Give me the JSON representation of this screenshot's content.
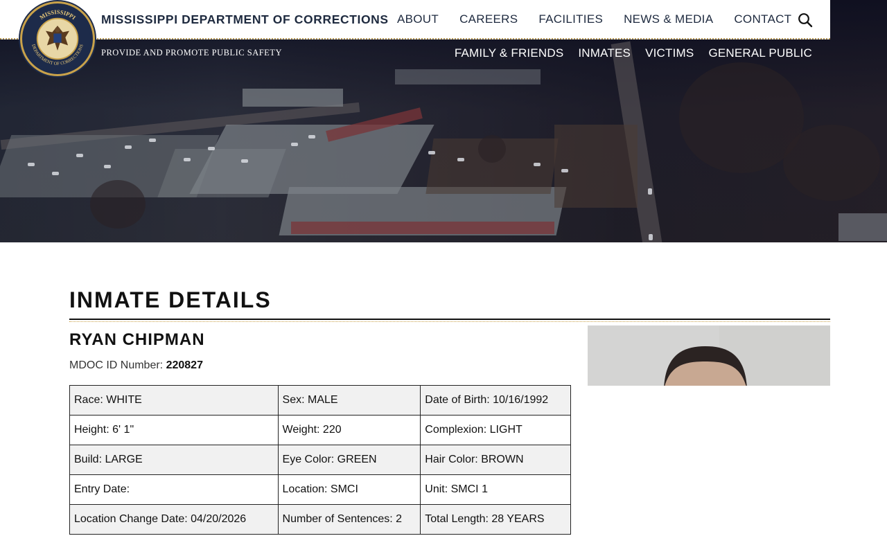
{
  "header": {
    "brand_title": "MISSISSIPPI DEPARTMENT OF CORRECTIONS",
    "tagline": "PROVIDE AND PROMOTE PUBLIC SAFETY",
    "seal_text_top": "MISSISSIPPI",
    "seal_text_bottom": "DEPARTMENT OF CORRECTIONS",
    "primary_nav": [
      {
        "label": "ABOUT"
      },
      {
        "label": "CAREERS"
      },
      {
        "label": "FACILITIES"
      },
      {
        "label": "NEWS & MEDIA"
      },
      {
        "label": "CONTACT"
      }
    ],
    "secondary_nav": [
      {
        "label": "FAMILY & FRIENDS"
      },
      {
        "label": "INMATES"
      },
      {
        "label": "VICTIMS"
      },
      {
        "label": "GENERAL PUBLIC"
      }
    ],
    "search_icon": "search-icon"
  },
  "colors": {
    "navy": "#1e2a3f",
    "gold": "#c9a24a"
  },
  "main": {
    "page_title": "INMATE DETAILS",
    "inmate_name": "RYAN CHIPMAN",
    "mdoc_label": "MDOC ID Number: ",
    "mdoc_value": "220827",
    "rows": [
      [
        "Race: WHITE",
        "Sex: MALE",
        "Date of Birth: 10/16/1992"
      ],
      [
        "Height: 6' 1\"",
        "Weight: 220",
        "Complexion: LIGHT"
      ],
      [
        "Build: LARGE",
        "Eye Color: GREEN",
        "Hair Color: BROWN"
      ],
      [
        "Entry Date:",
        "Location: SMCI",
        "Unit: SMCI 1"
      ],
      [
        "Location Change Date: 04/20/2026",
        "Number of Sentences: 2",
        "Total Length: 28 YEARS"
      ]
    ]
  }
}
